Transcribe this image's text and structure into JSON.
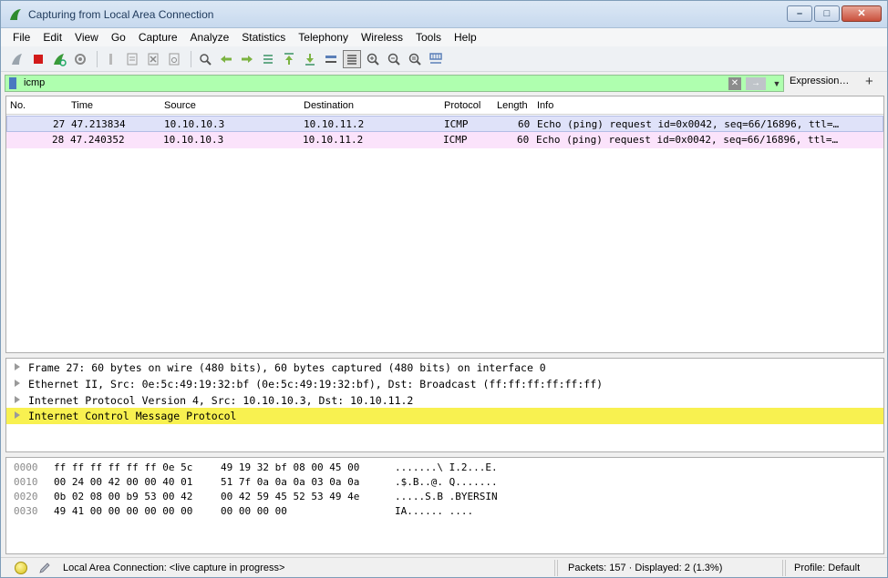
{
  "window": {
    "title": "Capturing from Local Area Connection",
    "minimize_glyph": "–",
    "maximize_glyph": "□",
    "close_glyph": "✕"
  },
  "menu": [
    "File",
    "Edit",
    "View",
    "Go",
    "Capture",
    "Analyze",
    "Statistics",
    "Telephony",
    "Wireless",
    "Tools",
    "Help"
  ],
  "toolbar_icons": [
    "shark-fin-start-icon",
    "stop-capture-icon",
    "restart-capture-icon",
    "capture-options-icon",
    "open-file-icon",
    "save-file-icon",
    "close-file-icon",
    "reload-file-icon",
    "find-packet-icon",
    "go-back-icon",
    "go-forward-icon",
    "go-to-packet-icon",
    "go-first-icon",
    "go-last-icon",
    "auto-scroll-icon",
    "colorize-icon",
    "zoom-in-icon",
    "zoom-out-icon",
    "normal-size-icon",
    "resize-columns-icon"
  ],
  "filter": {
    "value": "icmp",
    "clear_glyph": "✕",
    "apply_glyph": "→",
    "dropdown_glyph": "▼",
    "expression_label": "Expression…",
    "add_glyph": "+"
  },
  "packet_list": {
    "columns": [
      "No.",
      "Time",
      "Source",
      "Destination",
      "Protocol",
      "Length",
      "Info"
    ],
    "rows": [
      {
        "no": "27",
        "time": "47.213834",
        "source": "10.10.10.3",
        "destination": "10.10.11.2",
        "protocol": "ICMP",
        "length": "60",
        "info": "Echo (ping) request  id=0x0042, seq=66/16896, ttl=…"
      },
      {
        "no": "28",
        "time": "47.240352",
        "source": "10.10.10.3",
        "destination": "10.10.11.2",
        "protocol": "ICMP",
        "length": "60",
        "info": "Echo (ping) request  id=0x0042, seq=66/16896, ttl=…"
      }
    ]
  },
  "details": [
    "Frame 27: 60 bytes on wire (480 bits), 60 bytes captured (480 bits) on interface 0",
    "Ethernet II, Src: 0e:5c:49:19:32:bf (0e:5c:49:19:32:bf), Dst: Broadcast (ff:ff:ff:ff:ff:ff)",
    "Internet Protocol Version 4, Src: 10.10.10.3, Dst: 10.10.11.2",
    "Internet Control Message Protocol"
  ],
  "bytes": [
    {
      "offset": "0000",
      "hex1": "ff ff ff ff ff ff 0e 5c",
      "hex2": "49 19 32 bf 08 00 45 00",
      "ascii": ".......\\ I.2...E."
    },
    {
      "offset": "0010",
      "hex1": "00 24 00 42 00 00 40 01",
      "hex2": "51 7f 0a 0a 0a 03 0a 0a",
      "ascii": ".$.B..@. Q......."
    },
    {
      "offset": "0020",
      "hex1": "0b 02 08 00 b9 53 00 42",
      "hex2": "00 42 59 45 52 53 49 4e",
      "ascii": ".....S.B .BYERSIN"
    },
    {
      "offset": "0030",
      "hex1": "49 41 00 00 00 00 00 00",
      "hex2": "00 00 00 00",
      "ascii": "IA...... ...."
    }
  ],
  "status": {
    "capture_text": "Local Area Connection: <live capture in progress>",
    "packets_text": "Packets: 157 · Displayed: 2 (1.3%)",
    "profile_text": "Profile: Default"
  },
  "colors": {
    "filter_valid": "#afffaf",
    "row_icmp": "#fbe3fb",
    "row_selected": "#dfe2f9",
    "detail_selected": "#f8f150"
  }
}
